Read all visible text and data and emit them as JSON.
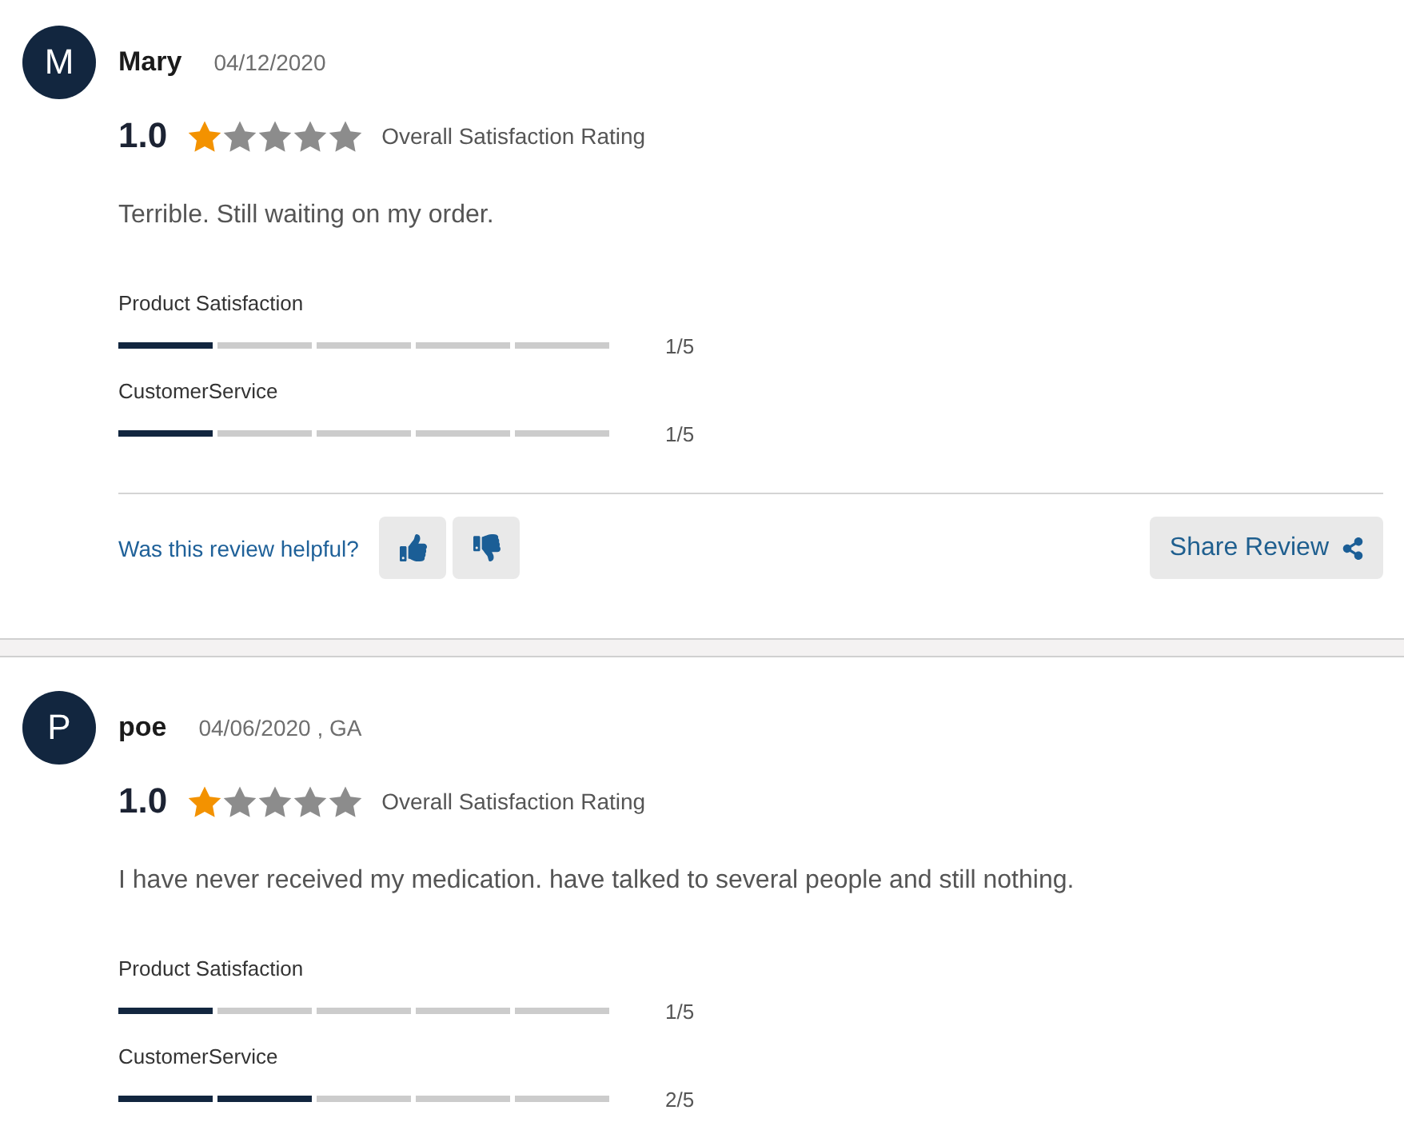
{
  "reviews": [
    {
      "initial": "M",
      "name": "Mary",
      "date": "04/12/2020",
      "score": "1.0",
      "stars": 1,
      "rating_label": "Overall Satisfaction Rating",
      "text": "Terrible. Still waiting on my order.",
      "metrics": [
        {
          "label": "Product Satisfaction",
          "level": 0.2,
          "reading": "1/5"
        },
        {
          "label": "CustomerService",
          "level": 0.2,
          "reading": "1/5"
        }
      ],
      "helpful_prompt": "Was this review helpful?",
      "share_button": "Share Review"
    },
    {
      "initial": "P",
      "name": "poe",
      "date": "04/06/2020 , GA",
      "score": "1.0",
      "stars": 1,
      "rating_label": "Overall Satisfaction Rating",
      "text": "I have never received my medication. have talked to several people and still nothing.",
      "metrics": [
        {
          "label": "Product Satisfaction",
          "level": 0.2,
          "reading": "1/5"
        },
        {
          "label": "CustomerService",
          "level": 0.4,
          "reading": "2/5"
        }
      ]
    }
  ]
}
